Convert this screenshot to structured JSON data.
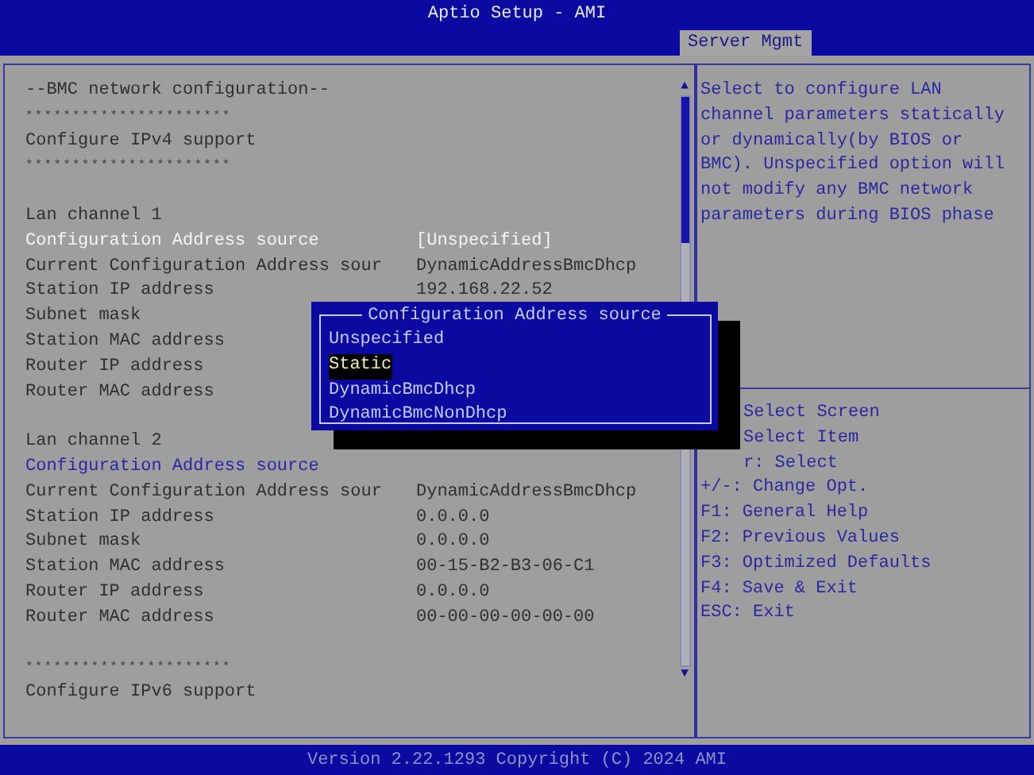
{
  "window": {
    "title": "Aptio Setup - AMI"
  },
  "tabs": [
    {
      "label": "Server Mgmt",
      "selected": true
    }
  ],
  "settings": [
    {
      "kind": "heading",
      "label": "--BMC network configuration--"
    },
    {
      "kind": "separator",
      "label": "**********************"
    },
    {
      "kind": "heading",
      "label": "Configure IPv4 support"
    },
    {
      "kind": "separator",
      "label": "**********************"
    },
    {
      "kind": "blank"
    },
    {
      "kind": "heading",
      "label": "Lan channel 1"
    },
    {
      "kind": "option",
      "label": "Configuration Address source",
      "value": "[Unspecified]",
      "selected": true
    },
    {
      "kind": "info",
      "label": "Current Configuration Address sour",
      "value": "DynamicAddressBmcDhcp"
    },
    {
      "kind": "info",
      "label": "Station IP address",
      "value": "192.168.22.52"
    },
    {
      "kind": "info",
      "label": "Subnet mask"
    },
    {
      "kind": "info",
      "label": "Station MAC address"
    },
    {
      "kind": "info",
      "label": "Router IP address"
    },
    {
      "kind": "info",
      "label": "Router MAC address"
    },
    {
      "kind": "blank"
    },
    {
      "kind": "heading",
      "label": "Lan channel 2"
    },
    {
      "kind": "option",
      "label": "Configuration Address source",
      "selected": false
    },
    {
      "kind": "info",
      "label": "Current Configuration Address sour",
      "value": "DynamicAddressBmcDhcp"
    },
    {
      "kind": "info",
      "label": "Station IP address",
      "value": "0.0.0.0"
    },
    {
      "kind": "info",
      "label": "Subnet mask",
      "value": "0.0.0.0"
    },
    {
      "kind": "info",
      "label": "Station MAC address",
      "value": "00-15-B2-B3-06-C1"
    },
    {
      "kind": "info",
      "label": "Router IP address",
      "value": "0.0.0.0"
    },
    {
      "kind": "info",
      "label": "Router MAC address",
      "value": "00-00-00-00-00-00"
    },
    {
      "kind": "blank"
    },
    {
      "kind": "separator",
      "label": "**********************"
    },
    {
      "kind": "heading",
      "label": "Configure IPv6 support"
    }
  ],
  "help_text": "Select to configure LAN channel parameters statically or dynamically(by BIOS or BMC). Unspecified option will not modify any BMC network parameters during BIOS phase",
  "key_help_partly_hidden": [
    "Select Screen",
    "Select Item",
    "r: Select"
  ],
  "key_help": [
    "+/-: Change Opt.",
    "F1: General Help",
    "F2: Previous Values",
    "F3: Optimized Defaults",
    "F4: Save & Exit",
    "ESC: Exit"
  ],
  "scroll_arrows": {
    "up": "▲",
    "down": "▼"
  },
  "popup": {
    "title": "Configuration Address source",
    "options": [
      {
        "label": "Unspecified",
        "selected": false
      },
      {
        "label": "Static",
        "selected": true
      },
      {
        "label": "DynamicBmcDhcp",
        "selected": false
      },
      {
        "label": "DynamicBmcNonDhcp",
        "selected": false
      }
    ]
  },
  "status_bar": "Version 2.22.1293 Copyright (C) 2024 AMI"
}
